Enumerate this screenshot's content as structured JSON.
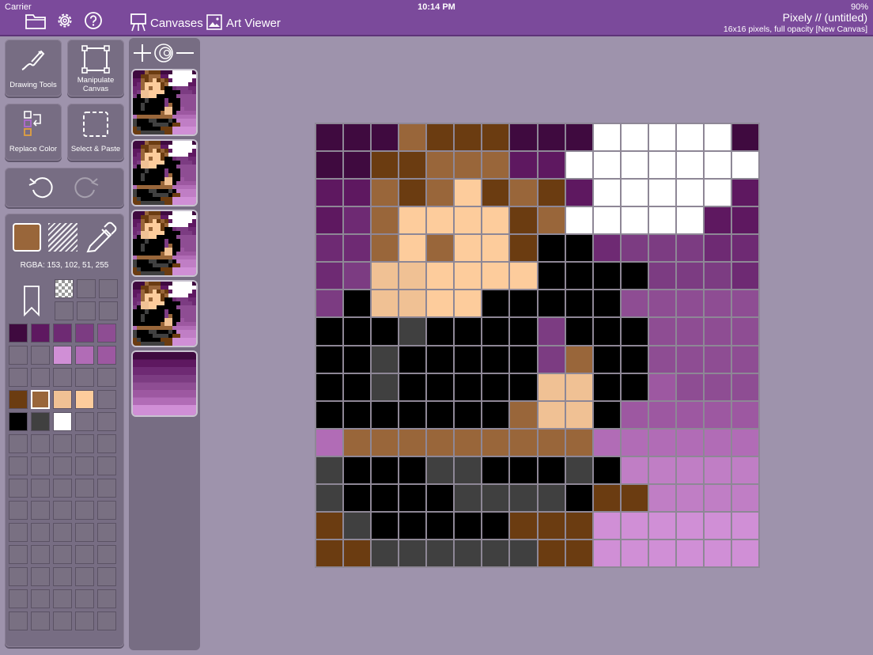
{
  "status_bar": {
    "carrier": "Carrier",
    "time": "10:14 PM",
    "battery": "90%"
  },
  "toolbar": {
    "icons": [
      "folder-icon",
      "gear-icon",
      "help-icon"
    ],
    "canvases_label": "Canvases",
    "art_viewer_label": "Art Viewer",
    "title": "Pixely // (untitled)",
    "subtitle": "16x16 pixels, full opacity [New Canvas]"
  },
  "tools": {
    "drawing_tools": "Drawing Tools",
    "manipulate_canvas": "Manipulate Canvas",
    "replace_color": "Replace Color",
    "select_paste": "Select & Paste"
  },
  "color": {
    "current": "#99663a",
    "rgba_text": "RGBA: 153, 102, 51, 255"
  },
  "palette": {
    "rows": [
      [
        "#3f0a3f",
        "#5e1860",
        "#6e2a73",
        "#7c3c82",
        "#8e4d93"
      ],
      [
        "#7a7083",
        "#7a7083",
        "#d08fd6",
        "#b16cb6",
        "#9d58a1"
      ],
      [
        "#7a7083",
        "#7a7083",
        "#7a7083",
        "#7a7083",
        "#7a7083"
      ],
      [
        "#6b3c11",
        "#99663a",
        "#f0c194",
        "#fdcc9c",
        "#7a7083"
      ],
      [
        "#000000",
        "#404040",
        "#ffffff",
        "#7a7083",
        "#7a7083"
      ]
    ],
    "selected_row": 3,
    "selected_col": 1
  },
  "canvas": {
    "palette": {
      "a": "#3f0a3f",
      "b": "#5e1860",
      "c": "#6e2a73",
      "d": "#7c3c82",
      "e": "#8e4d93",
      "f": "#9d58a1",
      "g": "#b16cb6",
      "h": "#c07ec5",
      "i": "#d08fd6",
      "n": "#6b3c11",
      "o": "#99663a",
      "p": "#fdcc9c",
      "q": "#f0c194",
      "k": "#000000",
      "l": "#404040",
      "w": "#ffffff"
    },
    "rows": [
      "aaaonnnaaawwwwwa",
      "aannooobbwwwwww",
      "bbonopnonbwwwwwb",
      "bcoppppnowwwwwb",
      "ccopoppnkkcdddcc",
      "cdqqppppkkkkdddc",
      "dkqqppkkkkkeeee",
      "kkklkkkkdkkkeeeeee",
      "kklkkkkkdokkeeee",
      "kklkkkkkqqkkfeeee",
      "kkkkkkkoqqkfffff",
      "goooooooooggggggg",
      "lkkkllkkklkhhhhhh",
      "lkkkkllllknnhhhhh",
      "nlkkkkknnniiiii",
      "nnllllllnniiiiii"
    ]
  }
}
